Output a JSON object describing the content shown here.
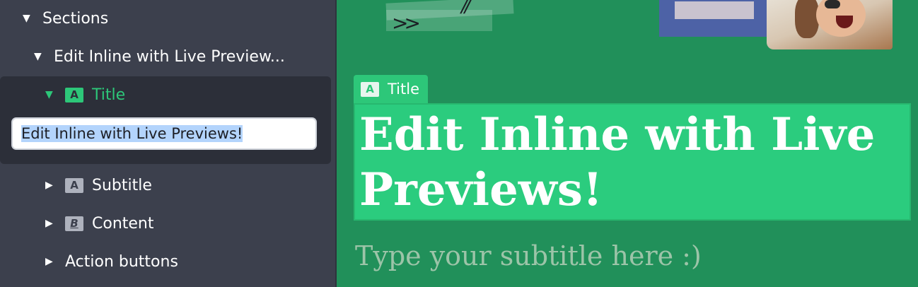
{
  "sidebar": {
    "sections_label": "Sections",
    "section_name": "Edit Inline with Live Preview...",
    "title_item": {
      "label": "Title",
      "badge": "A"
    },
    "inline_input_value": "Edit Inline with Live Previews!",
    "subtitle_item": {
      "label": "Subtitle",
      "badge": "A"
    },
    "content_item": {
      "label": "Content",
      "badge": "B"
    },
    "action_buttons_label": "Action buttons"
  },
  "preview": {
    "tag": {
      "label": "Title",
      "badge": "A"
    },
    "title": "Edit Inline with Live Previews!",
    "subtitle_placeholder": "Type your subtitle here :)",
    "deco_chevrons": ">>",
    "deco_slashes": "//"
  },
  "colors": {
    "accent": "#2dc779",
    "sidebar_bg": "#3c404d",
    "preview_bg": "#21905a"
  }
}
